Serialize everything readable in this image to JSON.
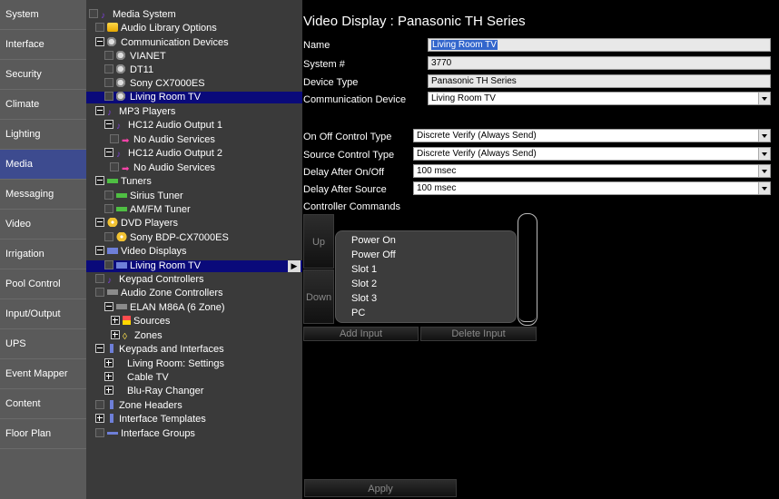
{
  "nav": {
    "items": [
      {
        "label": "System",
        "active": false
      },
      {
        "label": "Interface",
        "active": false
      },
      {
        "label": "Security",
        "active": false
      },
      {
        "label": "Climate",
        "active": false
      },
      {
        "label": "Lighting",
        "active": false
      },
      {
        "label": "Media",
        "active": true
      },
      {
        "label": "Messaging",
        "active": false
      },
      {
        "label": "Video",
        "active": false
      },
      {
        "label": "Irrigation",
        "active": false
      },
      {
        "label": "Pool Control",
        "active": false
      },
      {
        "label": "Input/Output",
        "active": false
      },
      {
        "label": "UPS",
        "active": false
      },
      {
        "label": "Event Mapper",
        "active": false
      },
      {
        "label": "Content",
        "active": false
      },
      {
        "label": "Floor Plan",
        "active": false
      }
    ]
  },
  "tree": {
    "rows": [
      {
        "label": "Media System",
        "icon": "music-note-icon"
      },
      {
        "label": "Audio Library Options",
        "icon": "audio-library-icon"
      },
      {
        "label": "Communication Devices",
        "icon": "satellite-icon"
      },
      {
        "label": "VIANET",
        "icon": "satellite-icon"
      },
      {
        "label": "DT11",
        "icon": "satellite-icon"
      },
      {
        "label": "Sony CX7000ES",
        "icon": "satellite-icon"
      },
      {
        "label": "Living Room TV",
        "icon": "satellite-icon"
      },
      {
        "label": "MP3 Players",
        "icon": "music-note-icon"
      },
      {
        "label": "HC12 Audio Output 1",
        "icon": "music-note-icon"
      },
      {
        "label": "No Audio Services",
        "icon": "audio-service-icon"
      },
      {
        "label": "HC12 Audio Output 2",
        "icon": "music-note-icon"
      },
      {
        "label": "No Audio Services",
        "icon": "audio-service-icon"
      },
      {
        "label": "Tuners",
        "icon": "tuner-icon"
      },
      {
        "label": "Sirius Tuner",
        "icon": "tuner-icon"
      },
      {
        "label": "AM/FM Tuner",
        "icon": "tuner-icon"
      },
      {
        "label": "DVD Players",
        "icon": "disc-icon"
      },
      {
        "label": "Sony BDP-CX7000ES",
        "icon": "disc-icon"
      },
      {
        "label": "Video Displays",
        "icon": "monitor-icon"
      },
      {
        "label": "Living Room TV",
        "icon": "monitor-icon"
      },
      {
        "label": "Keypad Controllers",
        "icon": "music-note-icon"
      },
      {
        "label": "Audio Zone Controllers",
        "icon": "zone-controller-icon"
      },
      {
        "label": "ELAN M86A (6 Zone)",
        "icon": "zone-controller-icon"
      },
      {
        "label": "Sources",
        "icon": "sources-icon"
      },
      {
        "label": "Zones",
        "icon": "zones-icon"
      },
      {
        "label": "Keypads and Interfaces",
        "icon": "keypad-icon"
      },
      {
        "label": "Living Room: Settings",
        "icon": ""
      },
      {
        "label": "Cable TV",
        "icon": ""
      },
      {
        "label": "Blu-Ray Changer",
        "icon": ""
      },
      {
        "label": "Zone Headers",
        "icon": "keypad-icon"
      },
      {
        "label": "Interface Templates",
        "icon": "keypad-icon"
      },
      {
        "label": "Interface Groups",
        "icon": "group-icon"
      }
    ]
  },
  "main": {
    "title": "Video Display : Panasonic TH Series",
    "name_label": "Name",
    "name_value": "Living Room TV",
    "system_label": "System #",
    "system_value": "3770",
    "device_type_label": "Device Type",
    "device_type_value": "Panasonic TH Series",
    "comm_device_label": "Communication Device",
    "comm_device_value": "Living Room TV",
    "onoff_label": "On Off Control Type",
    "onoff_value": "Discrete Verify (Always Send)",
    "source_ctrl_label": "Source Control Type",
    "source_ctrl_value": "Discrete Verify (Always Send)",
    "delay_onoff_label": "Delay After On/Off",
    "delay_onoff_value": "100 msec",
    "delay_source_label": "Delay After Source",
    "delay_source_value": "100 msec",
    "controller_commands_label": "Controller Commands",
    "up_label": "Up",
    "down_label": "Down",
    "commands": [
      "Power On",
      "Power Off",
      "Slot 1",
      "Slot 2",
      "Slot 3",
      "PC"
    ],
    "add_input_label": "Add Input",
    "delete_input_label": "Delete Input",
    "apply_label": "Apply"
  }
}
